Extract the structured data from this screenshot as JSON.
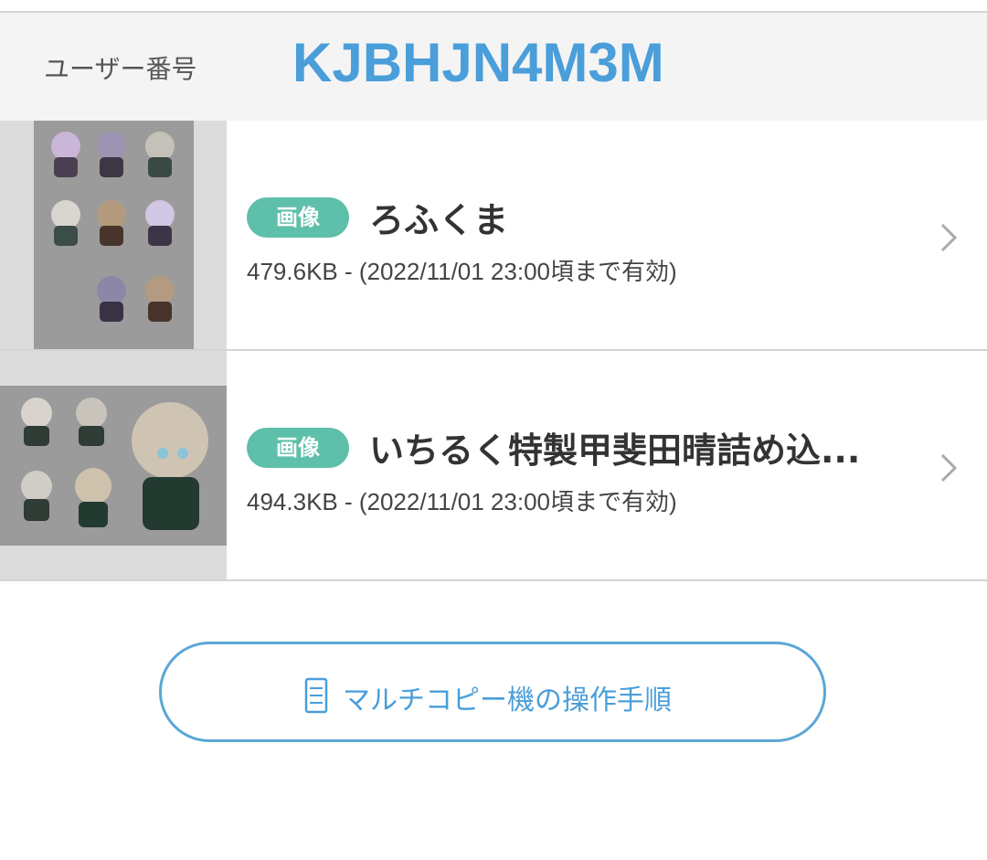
{
  "user": {
    "label": "ユーザー番号",
    "code": "KJBHJN4M3M"
  },
  "files": [
    {
      "tag": "画像",
      "title": "ろふくま",
      "meta": "479.6KB - (2022/11/01 23:00頃まで有効)",
      "thumbnail_alt": "bear sticker sheet"
    },
    {
      "tag": "画像",
      "title": "いちるく特製甲斐田晴詰め込...",
      "meta": "494.3KB - (2022/11/01 23:00頃まで有効)",
      "thumbnail_alt": "character sticker sheet"
    }
  ],
  "copy_button": {
    "label": "マルチコピー機の操作手順",
    "icon": "copier-icon"
  },
  "colors": {
    "accent": "#4a9ed9",
    "tag": "#5ebfaa",
    "divider": "#d4d4d4"
  }
}
